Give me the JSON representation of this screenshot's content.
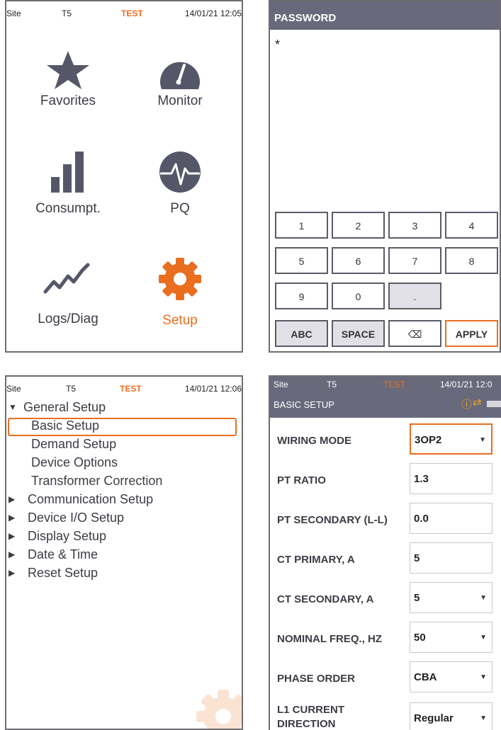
{
  "status": {
    "site": "Site",
    "device": "T5",
    "mode": "TEST",
    "time_main": "14/01/21 12:05",
    "time_tree": "14/01/21 12:06",
    "time_basic": "14/01/21 12:0"
  },
  "main_menu": {
    "tiles": [
      {
        "label": "Favorites",
        "icon": "star-icon"
      },
      {
        "label": "Monitor",
        "icon": "gauge-icon"
      },
      {
        "label": "Consumpt.",
        "icon": "bar-chart-icon"
      },
      {
        "label": "PQ",
        "icon": "pq-waveform-icon"
      },
      {
        "label": "Logs/Diag",
        "icon": "trend-line-icon"
      },
      {
        "label": "Setup",
        "icon": "gear-icon"
      }
    ]
  },
  "password": {
    "title": "PASSWORD",
    "value": "*",
    "keys": [
      "1",
      "2",
      "3",
      "4",
      "5",
      "6",
      "7",
      "8",
      "9",
      "0",
      "."
    ],
    "abc": "ABC",
    "space": "SPACE",
    "backspace": "⌫",
    "apply": "APPLY"
  },
  "setup_tree": {
    "items": [
      {
        "label": "General Setup",
        "expanded": true
      },
      {
        "label": "Basic Setup",
        "selected": true
      },
      {
        "label": "Demand Setup"
      },
      {
        "label": "Device Options"
      },
      {
        "label": "Transformer Correction"
      },
      {
        "label": "Communication Setup"
      },
      {
        "label": "Device I/O Setup"
      },
      {
        "label": "Display Setup"
      },
      {
        "label": "Date & Time"
      },
      {
        "label": "Reset Setup"
      }
    ]
  },
  "basic_setup": {
    "title": "BASIC SETUP",
    "rows": [
      {
        "label": "WIRING MODE",
        "value": "3OP2",
        "dropdown": true
      },
      {
        "label": "PT RATIO",
        "value": "1.3",
        "dropdown": false
      },
      {
        "label": "PT SECONDARY (L-L)",
        "value": "0.0",
        "dropdown": false
      },
      {
        "label": "CT PRIMARY, A",
        "value": "5",
        "dropdown": false
      },
      {
        "label": "CT SECONDARY, A",
        "value": "5",
        "dropdown": true
      },
      {
        "label": "NOMINAL FREQ., HZ",
        "value": "50",
        "dropdown": true
      },
      {
        "label": "PHASE ORDER",
        "value": "CBA",
        "dropdown": true
      },
      {
        "label": "L1 CURRENT",
        "label2": "DIRECTION",
        "value": "Regular",
        "dropdown": true
      }
    ]
  },
  "colors": {
    "accent": "#e96e1f",
    "icon": "#555769",
    "header": "#686a7c"
  }
}
